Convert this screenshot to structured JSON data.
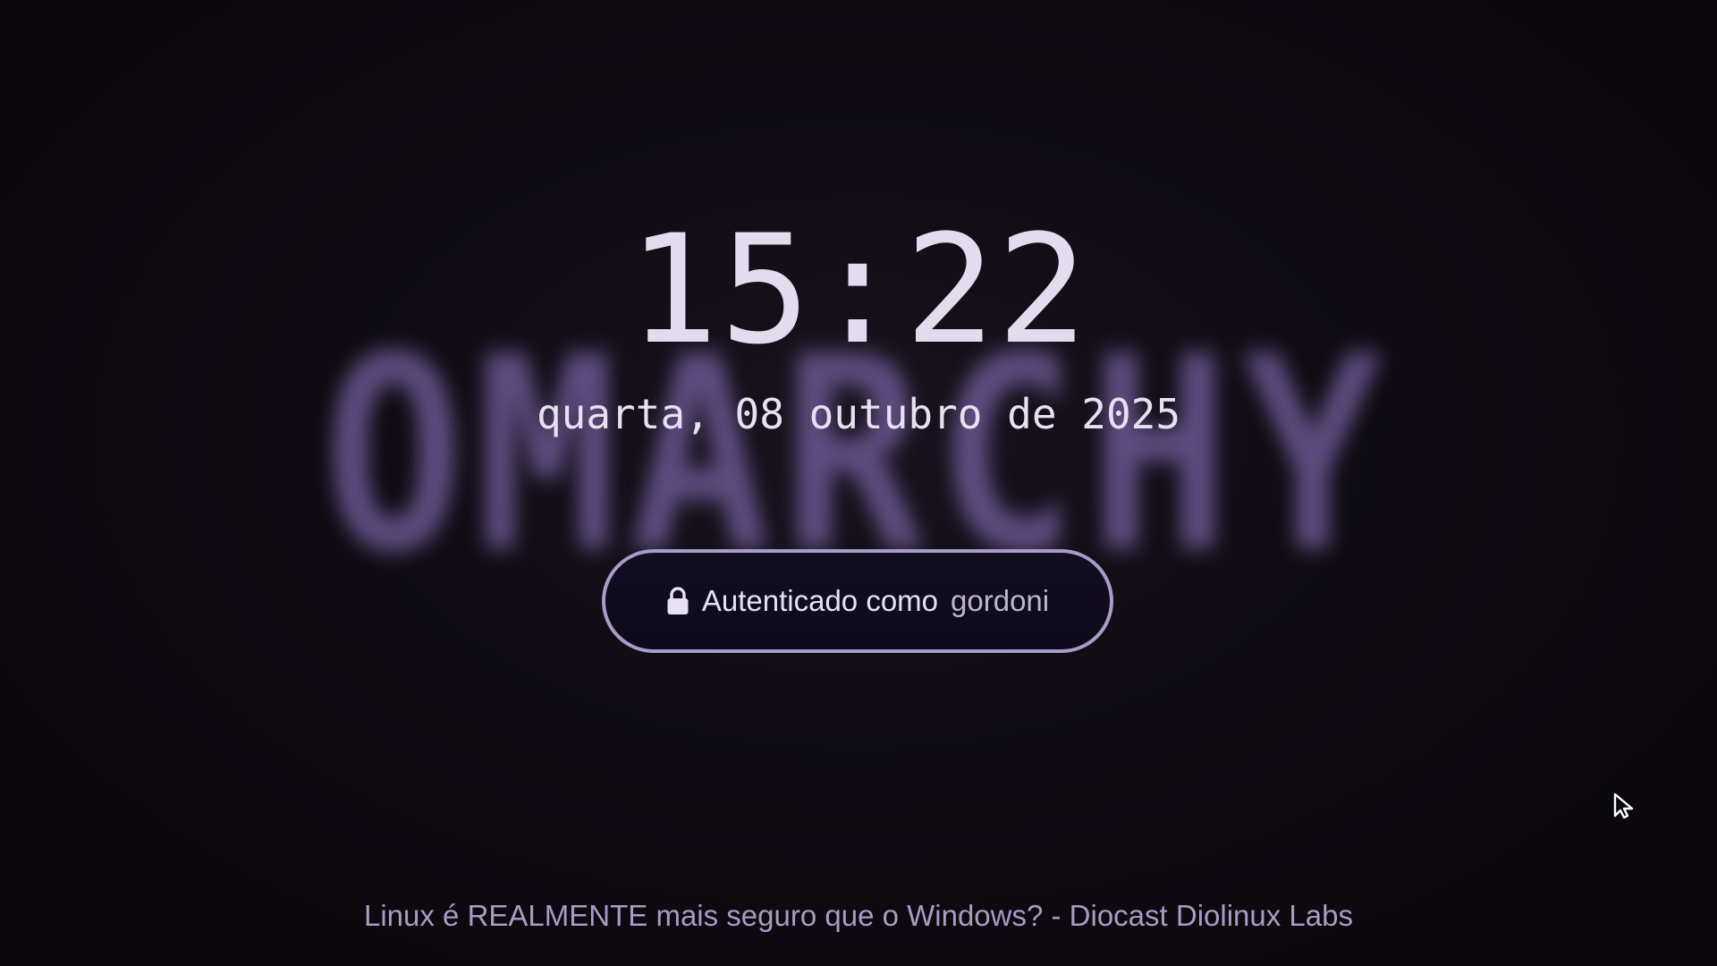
{
  "background": {
    "logo_text": "OMARCHY",
    "logo_color": "#7b64a8"
  },
  "clock": {
    "time": "15:22",
    "date": "quarta, 08 outubro de 2025"
  },
  "auth": {
    "label": "Autenticado como",
    "user": "gordoni",
    "icon": "lock-icon",
    "border_color": "#a99cc9"
  },
  "media": {
    "now_playing": "Linux é REALMENTE mais seguro que o Windows? - Diocast Diolinux Labs"
  },
  "cursor": {
    "icon": "cursor-icon"
  }
}
